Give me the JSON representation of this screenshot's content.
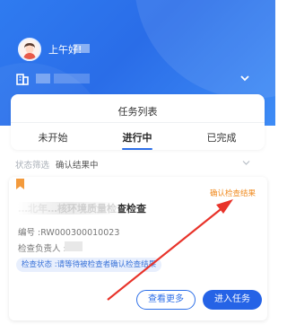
{
  "header": {
    "greeting": "上午好!"
  },
  "task_tabs": {
    "title": "任务列表",
    "tabs": [
      {
        "label": "未开始",
        "active": false
      },
      {
        "label": "进行中",
        "active": true
      },
      {
        "label": "已完成",
        "active": false
      }
    ]
  },
  "filter": {
    "label": "状态筛选",
    "value": "确认结果中"
  },
  "task": {
    "status_tag": "确认检查结果",
    "title": "…北年…核环境质量检查检查",
    "code": "编号 :RW000300010023",
    "owner_label": "检查负责人 :",
    "status_note": "检查状态 :请等待被检查者确认检查结果",
    "actions": {
      "more": "查看更多",
      "enter": "进入任务"
    }
  },
  "colors": {
    "primary": "#2d6fe8",
    "status_orange": "#f08a1e",
    "annotation_red": "#e8332a"
  },
  "icons": {
    "avatar": "avatar-icon",
    "org": "building-icon",
    "bookmark": "bookmark-icon",
    "chevron": "chevron-down-icon"
  }
}
